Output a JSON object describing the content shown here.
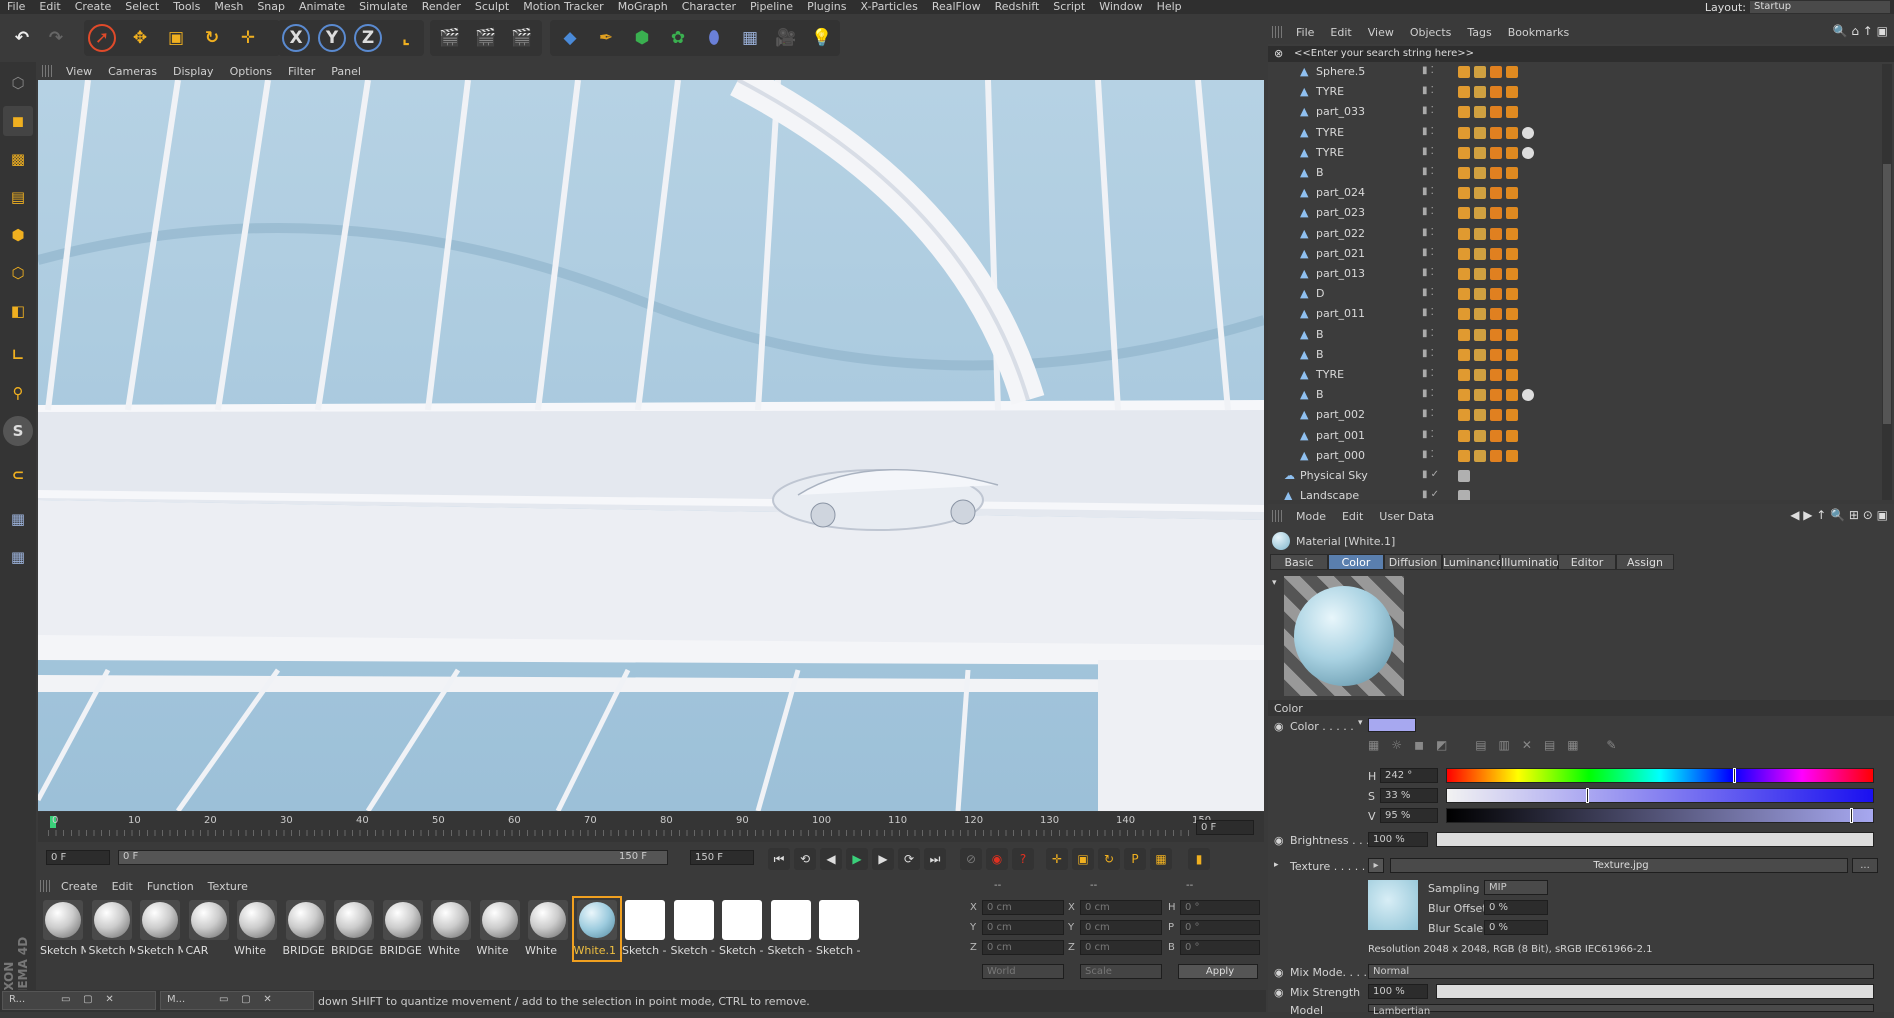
{
  "app": {
    "layout_label": "Layout:",
    "layout_value": "Startup"
  },
  "menu": [
    "File",
    "Edit",
    "Create",
    "Select",
    "Tools",
    "Mesh",
    "Snap",
    "Animate",
    "Simulate",
    "Render",
    "Sculpt",
    "Motion Tracker",
    "MoGraph",
    "Character",
    "Pipeline",
    "Plugins",
    "X-Particles",
    "RealFlow",
    "Redshift",
    "Script",
    "Window",
    "Help"
  ],
  "viewport_menu": [
    "View",
    "Cameras",
    "Display",
    "Options",
    "Filter",
    "Panel"
  ],
  "timeline": {
    "ticks": [
      "0",
      "10",
      "20",
      "30",
      "40",
      "50",
      "60",
      "70",
      "80",
      "90",
      "100",
      "110",
      "120",
      "130",
      "140",
      "150"
    ],
    "current_frame": "0 F"
  },
  "controls": {
    "start": "0 F",
    "range_start": "0 F",
    "range_end": "150 F",
    "end": "150 F"
  },
  "material_menu": [
    "Create",
    "Edit",
    "Function",
    "Texture"
  ],
  "materials": [
    "Sketch M",
    "Sketch M",
    "Sketch M",
    "CAR",
    "White",
    "BRIDGE",
    "BRIDGE",
    "BRIDGE",
    "White",
    "White",
    "White",
    "White.1",
    "Sketch -",
    "Sketch -",
    "Sketch -",
    "Sketch -",
    "Sketch -"
  ],
  "coord": {
    "header": "--",
    "x": "0 cm",
    "y": "0 cm",
    "z": "0 cm",
    "h": "0 °",
    "p": "0 °",
    "b": "0 °",
    "world": "World",
    "scale": "Scale",
    "apply": "Apply"
  },
  "status": "down SHIFT to quantize movement / add to the selection in point mode, CTRL to remove.",
  "taskbar": [
    "R...",
    "M..."
  ],
  "object_menu": [
    "File",
    "Edit",
    "View",
    "Objects",
    "Tags",
    "Bookmarks"
  ],
  "search_placeholder": "<<Enter your search string here>>",
  "objects": [
    "Sphere.5",
    "TYRE",
    "part_033",
    "TYRE",
    "TYRE",
    "B",
    "part_024",
    "part_023",
    "part_022",
    "part_021",
    "part_013",
    "D",
    "part_011",
    "B",
    "B",
    "TYRE",
    "B",
    "part_002",
    "part_001",
    "part_000",
    "Physical Sky",
    "Landscape"
  ],
  "attr_menu": [
    "Mode",
    "Edit",
    "User Data"
  ],
  "material_title": "Material [White.1]",
  "attr_tabs": [
    "Basic",
    "Color",
    "Diffusion",
    "Luminance",
    "Illumination",
    "Editor",
    "Assign"
  ],
  "color_section": "Color",
  "color_label": "Color . . . . .",
  "color_hex": "#a7a8f0",
  "hsv": {
    "h_label": "H",
    "h": "242 °",
    "h_frac": 0.672,
    "s_label": "S",
    "s": "33 %",
    "s_frac": 0.33,
    "v_label": "V",
    "v": "95 %",
    "v_frac": 0.95
  },
  "brightness_label": "Brightness . . .",
  "brightness": "100 %",
  "texture_label": "Texture . . . . .",
  "texture_file": "Texture.jpg",
  "texture_more": "...",
  "sampling_label": "Sampling",
  "sampling": "MIP",
  "blur_offset_label": "Blur Offset",
  "blur_offset": "0 %",
  "blur_scale_label": "Blur Scale",
  "blur_scale": "0 %",
  "resolution": "Resolution 2048 x 2048, RGB (8 Bit), sRGB IEC61966-2.1",
  "mix_mode_label": "Mix Mode. . . .",
  "mix_mode": "Normal",
  "mix_strength_label": "Mix Strength",
  "mix_strength": "100 %",
  "model_label": "Model",
  "model": "Lambertian",
  "toolbar_xyz": [
    "X",
    "Y",
    "Z"
  ]
}
